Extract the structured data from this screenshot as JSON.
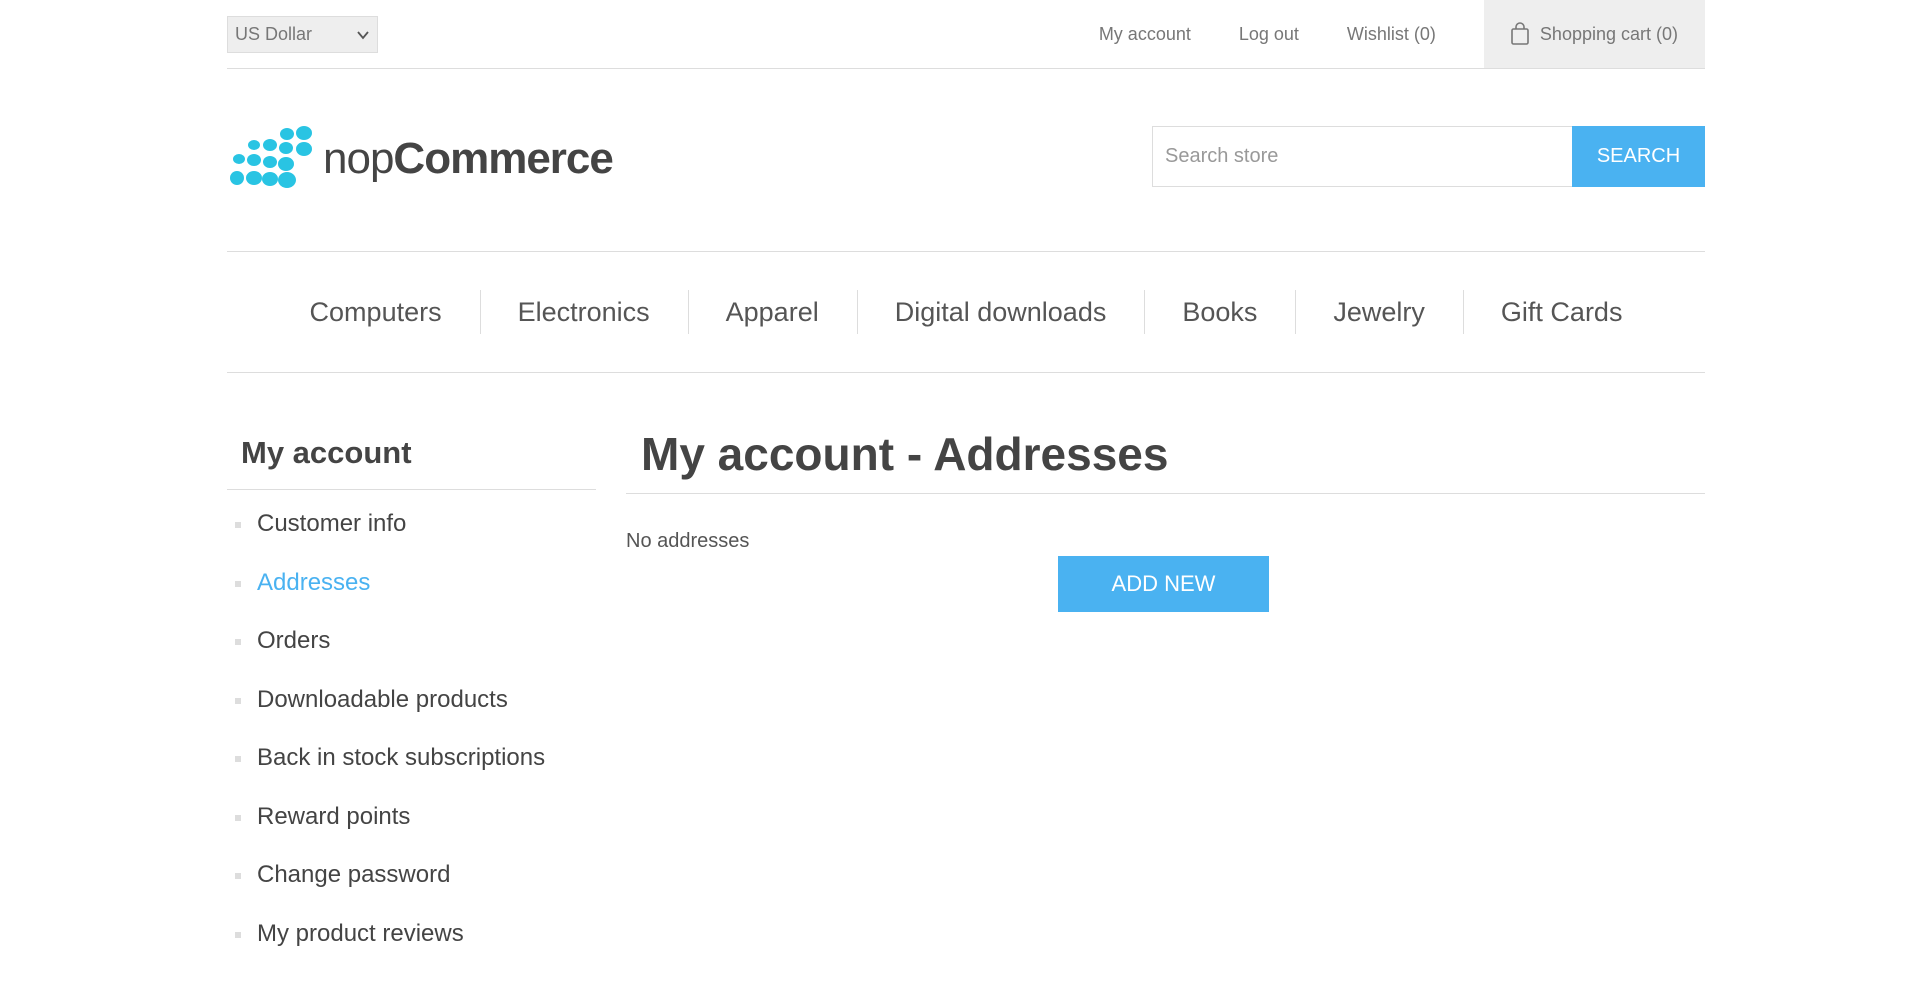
{
  "header": {
    "currency": {
      "selected": "US Dollar",
      "icon": "chevron-down-icon"
    },
    "links": {
      "my_account": "My account",
      "log_out": "Log out",
      "wishlist": "Wishlist (0)",
      "shopping_cart": "Shopping cart (0)",
      "cart_icon": "shopping-bag-icon"
    }
  },
  "logo": {
    "text_light": "nop",
    "text_bold": "Commerce",
    "icon": "dots-logo-icon"
  },
  "search": {
    "placeholder": "Search store",
    "value": "",
    "button_label": "SEARCH"
  },
  "menu": [
    {
      "label": "Computers"
    },
    {
      "label": "Electronics"
    },
    {
      "label": "Apparel"
    },
    {
      "label": "Digital downloads"
    },
    {
      "label": "Books"
    },
    {
      "label": "Jewelry"
    },
    {
      "label": "Gift Cards"
    }
  ],
  "sidebar": {
    "title": "My account",
    "items": [
      {
        "label": "Customer info"
      },
      {
        "label": "Addresses",
        "active": true
      },
      {
        "label": "Orders"
      },
      {
        "label": "Downloadable products"
      },
      {
        "label": "Back in stock subscriptions"
      },
      {
        "label": "Reward points"
      },
      {
        "label": "Change password"
      },
      {
        "label": "My product reviews"
      }
    ]
  },
  "main": {
    "title": "My account - Addresses",
    "empty_text": "No addresses",
    "add_new_label": "ADD NEW"
  },
  "colors": {
    "accent": "#4ab2f1",
    "logo_dots": "#29c4e3",
    "text": "#444444",
    "border": "#dddddd"
  }
}
